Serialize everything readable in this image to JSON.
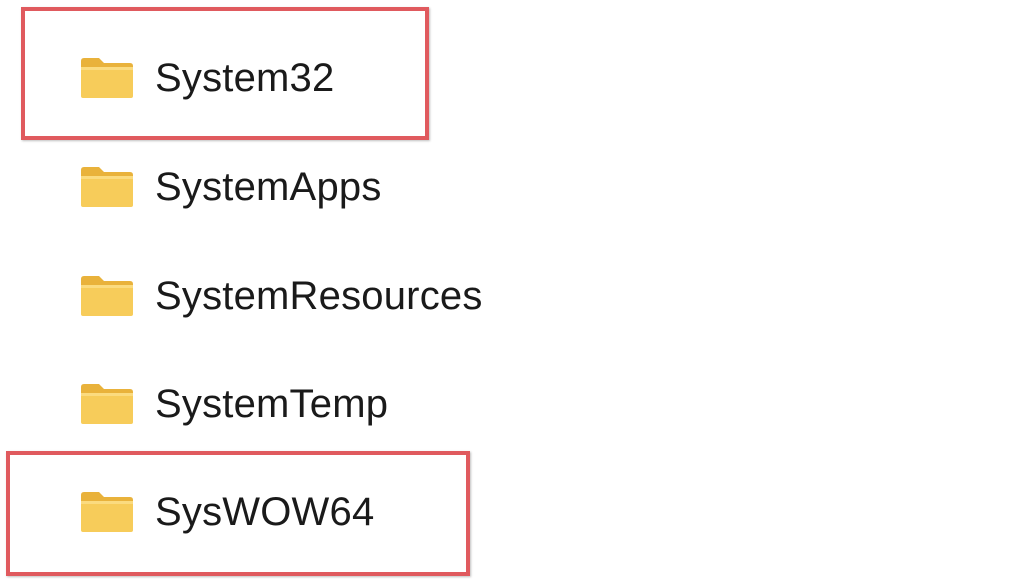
{
  "folders": [
    {
      "name": "System32",
      "icon": "folder-icon",
      "highlighted": true
    },
    {
      "name": "SystemApps",
      "icon": "folder-icon",
      "highlighted": false
    },
    {
      "name": "SystemResources",
      "icon": "folder-icon",
      "highlighted": false
    },
    {
      "name": "SystemTemp",
      "icon": "folder-icon",
      "highlighted": false
    },
    {
      "name": "SysWOW64",
      "icon": "folder-icon",
      "highlighted": true
    }
  ],
  "colors": {
    "highlight_border": "#e05a5e",
    "folder_front": "#f7cc5a",
    "folder_back": "#e9b23b",
    "text": "#1a1a1a",
    "background": "#ffffff"
  }
}
